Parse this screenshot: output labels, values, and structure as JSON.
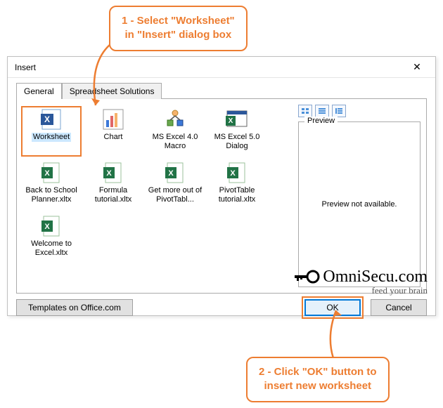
{
  "callouts": {
    "one": "1 - Select \"Worksheet\"\nin \"Insert\" dialog box",
    "two": "2 - Click \"OK\" button to\ninsert new worksheet"
  },
  "dialog": {
    "title": "Insert",
    "close_glyph": "✕",
    "tabs": {
      "general": "General",
      "solutions": "Spreadsheet Solutions"
    },
    "templates": [
      {
        "label": "Worksheet",
        "selected": true,
        "icon": "xl-blue"
      },
      {
        "label": "Chart",
        "icon": "chart"
      },
      {
        "label": "MS Excel 4.0 Macro",
        "icon": "macro"
      },
      {
        "label": "MS Excel 5.0 Dialog",
        "icon": "dialog5"
      },
      {
        "label": "Back to School Planner.xltx",
        "icon": "xl-green"
      },
      {
        "label": "Formula tutorial.xltx",
        "icon": "xl-green"
      },
      {
        "label": "Get more out of PivotTabl...",
        "icon": "xl-green"
      },
      {
        "label": "PivotTable tutorial.xltx",
        "icon": "xl-green"
      },
      {
        "label": "Welcome to Excel.xltx",
        "icon": "xl-green"
      }
    ],
    "preview_label": "Preview",
    "preview_message": "Preview not available.",
    "buttons": {
      "templates_office": "Templates on Office.com",
      "ok": "OK",
      "cancel": "Cancel"
    }
  },
  "watermark": {
    "name": "OmniSecu.com",
    "tagline": "feed your brain"
  }
}
